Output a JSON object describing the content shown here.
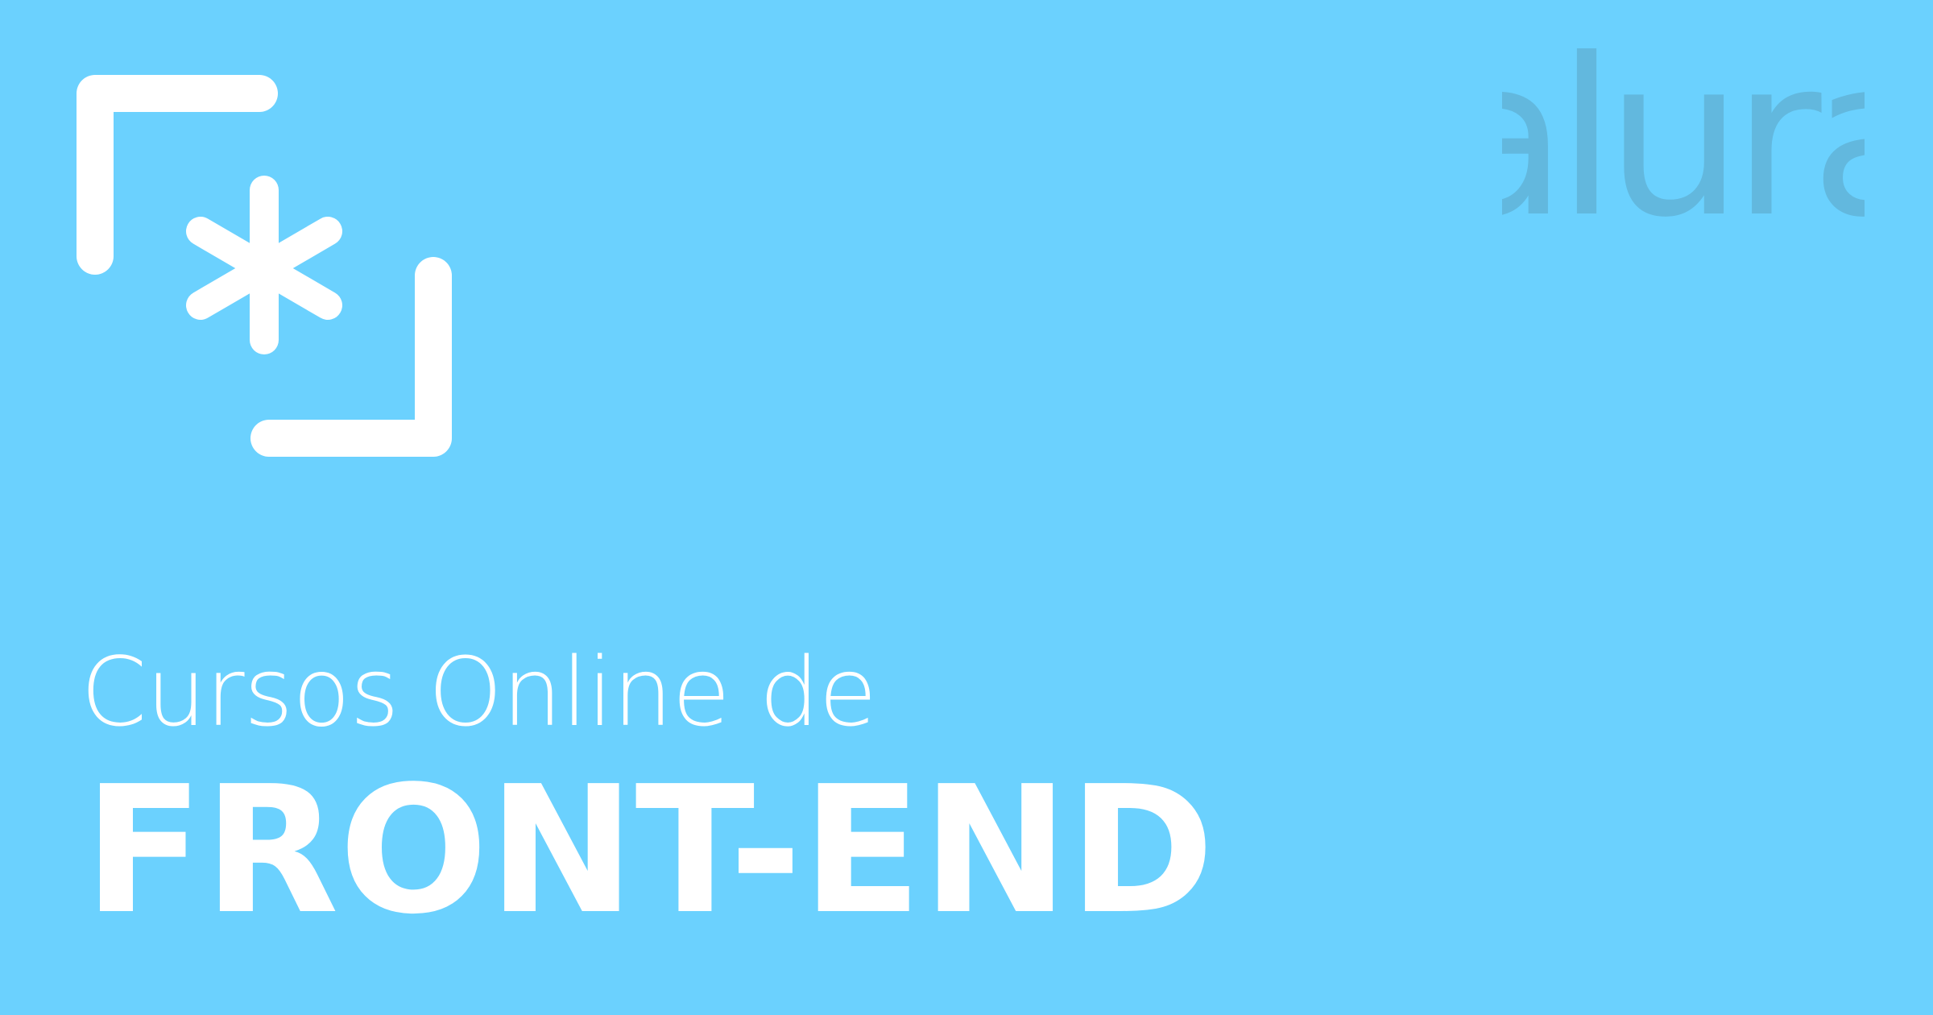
{
  "brand": {
    "logo_text": "alura",
    "logo_color": "#62b8de"
  },
  "icon": {
    "name": "code-bracket-asterisk-icon",
    "color": "#ffffff"
  },
  "heading": {
    "subtitle": "Cursos Online de",
    "title": "FRONT-END"
  },
  "colors": {
    "background": "#6bd1fe",
    "text": "#ffffff"
  }
}
